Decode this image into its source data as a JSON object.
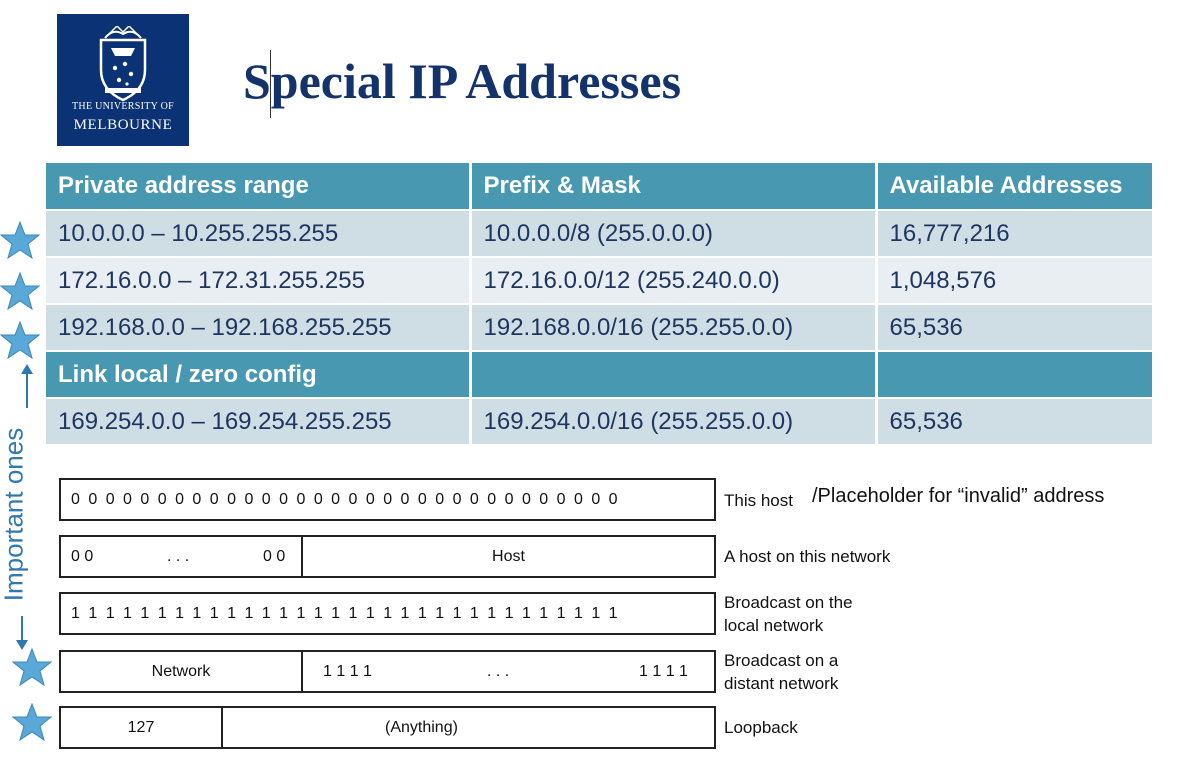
{
  "logo": {
    "line1": "THE UNIVERSITY OF",
    "line2": "MELBOURNE"
  },
  "title": "Special IP Addresses",
  "table": {
    "headers": [
      "Private address range",
      "Prefix & Mask",
      "Available Addresses"
    ],
    "rows": [
      [
        "10.0.0.0 – 10.255.255.255",
        "10.0.0.0/8 (255.0.0.0)",
        "16,777,216"
      ],
      [
        "172.16.0.0 – 172.31.255.255",
        "172.16.0.0/12 (255.240.0.0)",
        "1,048,576"
      ],
      [
        "192.168.0.0 – 192.168.255.255",
        "192.168.0.0/16 (255.255.0.0)",
        "65,536"
      ]
    ],
    "subheader": "Link local / zero config",
    "link_local_row": [
      "169.254.0.0 – 169.254.255.255",
      "169.254.0.0/16 (255.255.0.0)",
      "65,536"
    ]
  },
  "side_label": "Important ones",
  "diagrams": {
    "this_host": {
      "bits": "0 0 0 0 0 0 0 0 0 0 0 0 0 0 0 0 0 0 0 0 0 0 0 0 0 0 0 0 0 0 0 0",
      "desc_a": "This host",
      "desc_b": "/Placeholder for “invalid” address"
    },
    "host_on_network": {
      "left": "0 0",
      "dots": ". . .",
      "right": "0 0",
      "host": "Host",
      "desc": "A host on this network"
    },
    "broadcast_local": {
      "bits": "1 1 1 1 1 1 1 1 1 1 1 1 1 1 1 1 1 1 1 1 1 1 1 1 1 1 1 1 1 1 1 1",
      "desc1": "Broadcast on the",
      "desc2": "local network"
    },
    "broadcast_distant": {
      "network": "Network",
      "left": "1 1 1 1",
      "dots": ". . .",
      "right": "1 1 1 1",
      "desc1": "Broadcast on a",
      "desc2": "distant network"
    },
    "loopback": {
      "first": "127",
      "rest": "(Anything)",
      "desc": "Loopback"
    }
  },
  "colors": {
    "header": "#4798b0",
    "row_dark": "#cfdde5",
    "row_light": "#e8eef2",
    "logo_bg": "#0b3275",
    "title": "#14336b",
    "star": "#5aa8d8"
  },
  "icons": [
    "university-crest-icon",
    "star-icon",
    "arrow-up-icon",
    "arrow-down-icon"
  ]
}
